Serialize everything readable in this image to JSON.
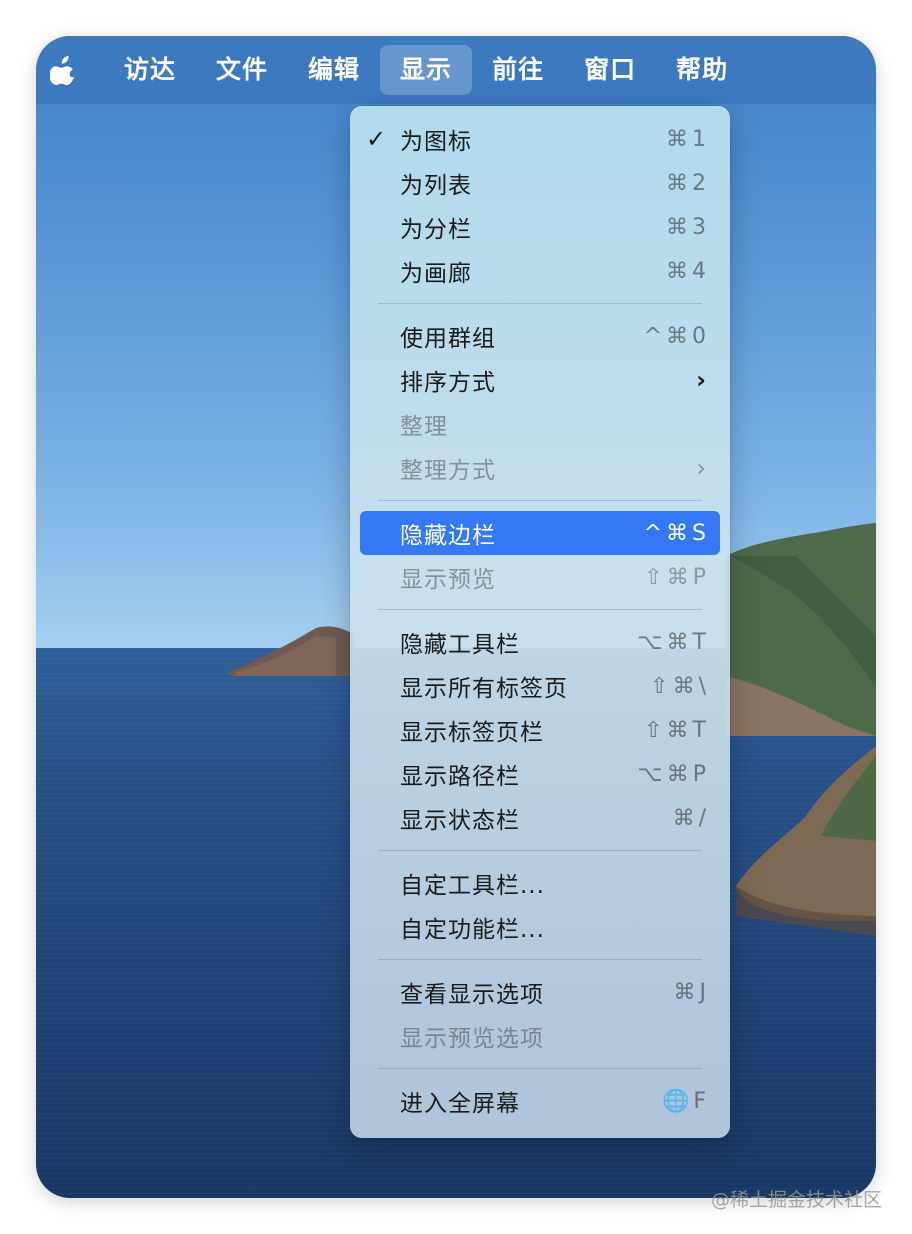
{
  "menubar": {
    "apple_icon": "apple-logo-icon",
    "items": [
      {
        "label": "访达"
      },
      {
        "label": "文件"
      },
      {
        "label": "编辑"
      },
      {
        "label": "显示",
        "active": true
      },
      {
        "label": "前往"
      },
      {
        "label": "窗口"
      },
      {
        "label": "帮助"
      }
    ]
  },
  "dropdown": {
    "groups": [
      [
        {
          "label": "为图标",
          "shortcut": "⌘1",
          "checked": true
        },
        {
          "label": "为列表",
          "shortcut": "⌘2"
        },
        {
          "label": "为分栏",
          "shortcut": "⌘3"
        },
        {
          "label": "为画廊",
          "shortcut": "⌘4"
        }
      ],
      [
        {
          "label": "使用群组",
          "shortcut": "^⌘0"
        },
        {
          "label": "排序方式",
          "submenu": true
        },
        {
          "label": "整理",
          "disabled": true
        },
        {
          "label": "整理方式",
          "submenu": true,
          "disabled": true
        }
      ],
      [
        {
          "label": "隐藏边栏",
          "shortcut": "^⌘S",
          "highlighted": true
        },
        {
          "label": "显示预览",
          "shortcut": "⇧⌘P",
          "disabled": true
        }
      ],
      [
        {
          "label": "隐藏工具栏",
          "shortcut": "⌥⌘T"
        },
        {
          "label": "显示所有标签页",
          "shortcut": "⇧⌘\\"
        },
        {
          "label": "显示标签页栏",
          "shortcut": "⇧⌘T"
        },
        {
          "label": "显示路径栏",
          "shortcut": "⌥⌘P"
        },
        {
          "label": "显示状态栏",
          "shortcut": "⌘/"
        }
      ],
      [
        {
          "label": "自定工具栏..."
        },
        {
          "label": "自定功能栏..."
        }
      ],
      [
        {
          "label": "查看显示选项",
          "shortcut": "⌘J"
        },
        {
          "label": "显示预览选项",
          "disabled": true
        }
      ],
      [
        {
          "label": "进入全屏幕",
          "shortcut": "🌐F"
        }
      ]
    ],
    "check_glyph": "✓",
    "submenu_glyph": "›"
  },
  "watermark": "@稀土掘金技术社区",
  "colors": {
    "highlight": "#3478f6",
    "menubar": "#3c78be"
  }
}
